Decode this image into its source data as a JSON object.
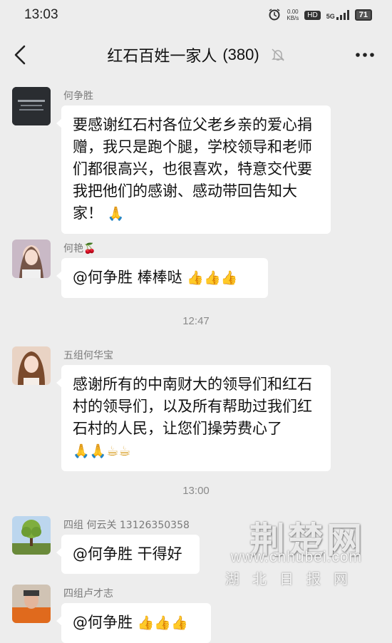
{
  "status_bar": {
    "time": "13:03",
    "net_speed_value": "0.00",
    "net_speed_unit": "KB/s",
    "hd": "HD",
    "network": "5G",
    "battery": "71"
  },
  "header": {
    "title": "红石百姓一家人",
    "member_count": "(380)"
  },
  "messages": [
    {
      "sender": "何争胜",
      "text": "要感谢红石村各位父老乡亲的爱心捐赠，我只是跑个腿，学校领导和老师们都很高兴，也很喜欢，特意交代要我把他们的感谢、感动带回告知大家！",
      "emoji": "🙏"
    },
    {
      "sender": "何艳🍒",
      "text": "@何争胜  棒棒哒",
      "emoji": "👍👍👍"
    },
    {
      "timestamp": "12:47"
    },
    {
      "sender": "五组何华宝",
      "text": "感谢所有的中南财大的领导们和红石村的领导们，以及所有帮助过我们红石村的人民，让您们操劳费心了",
      "emoji": "🙏🙏☕☕"
    },
    {
      "timestamp": "13:00"
    },
    {
      "sender": "四组   何云关  13126350358",
      "text": "@何争胜   干得好",
      "emoji": ""
    },
    {
      "sender": "四组卢才志",
      "text": "@何争胜  ",
      "emoji": "👍👍👍"
    }
  ],
  "watermark": {
    "main": "荆楚网",
    "url": "www.cnhubei.com",
    "sub": "湖北日报网"
  },
  "colors": {
    "background": "#ededed",
    "bubble": "#ffffff",
    "sender_text": "#7a7a7a"
  }
}
